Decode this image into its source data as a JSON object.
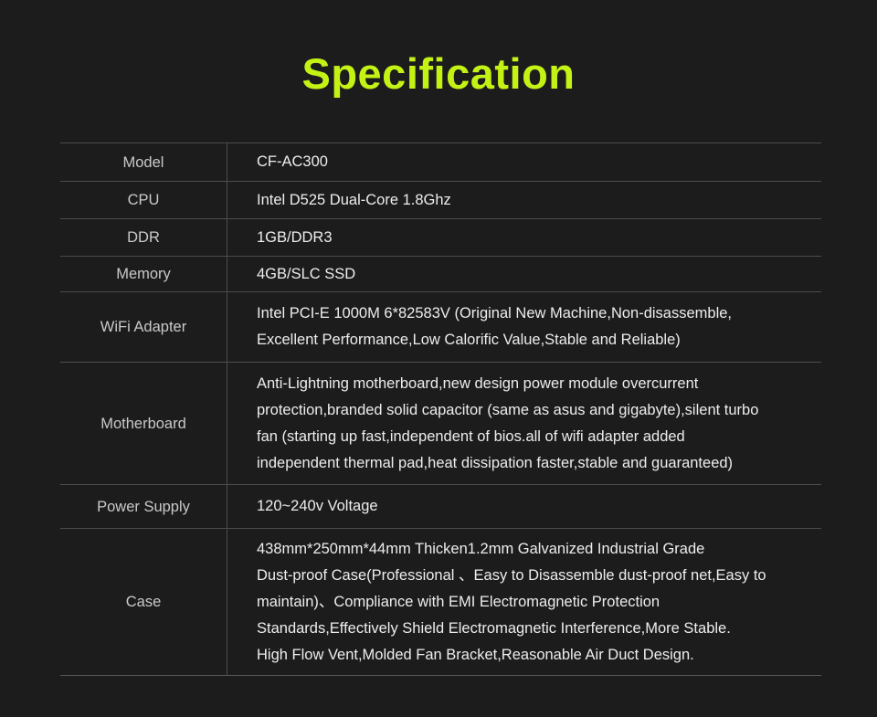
{
  "page": {
    "background_color": "#1c1c1c",
    "title": "Specification",
    "title_color": "#c4f215",
    "label_color": "#c9c9c9",
    "value_color": "#ededed",
    "border_color": "#4c4c4c"
  },
  "spec_table": {
    "rows": [
      {
        "label": "Model",
        "lines": [
          "CF-AC300"
        ]
      },
      {
        "label": "CPU",
        "lines": [
          "Intel D525 Dual-Core 1.8Ghz"
        ]
      },
      {
        "label": "DDR",
        "lines": [
          "1GB/DDR3"
        ]
      },
      {
        "label": "Memory",
        "lines": [
          "4GB/SLC SSD"
        ]
      },
      {
        "label": "WiFi Adapter",
        "lines": [
          "Intel PCI-E 1000M 6*82583V (Original New Machine,Non-disassemble,",
          "Excellent  Performance,Low Calorific Value,Stable and Reliable)"
        ]
      },
      {
        "label": "Motherboard",
        "lines": [
          "Anti-Lightning motherboard,new design power module overcurrent",
          "protection,branded solid capacitor (same as asus and gigabyte),silent turbo",
          "fan (starting up fast,independent of bios.all of wifi adapter added",
          "independent thermal pad,heat dissipation faster,stable and guaranteed)"
        ]
      },
      {
        "label": "Power Supply",
        "lines": [
          "120~240v Voltage"
        ]
      },
      {
        "label": "Case",
        "lines": [
          "438mm*250mm*44mm Thicken1.2mm Galvanized Industrial Grade",
          "Dust-proof Case(Professional 、Easy to Disassemble dust-proof net,Easy to",
          "maintain)、Compliance with EMI Electromagnetic Protection",
          "Standards,Effectively Shield Electromagnetic Interference,More Stable.",
          "High Flow Vent,Molded Fan Bracket,Reasonable Air Duct Design."
        ]
      }
    ]
  }
}
